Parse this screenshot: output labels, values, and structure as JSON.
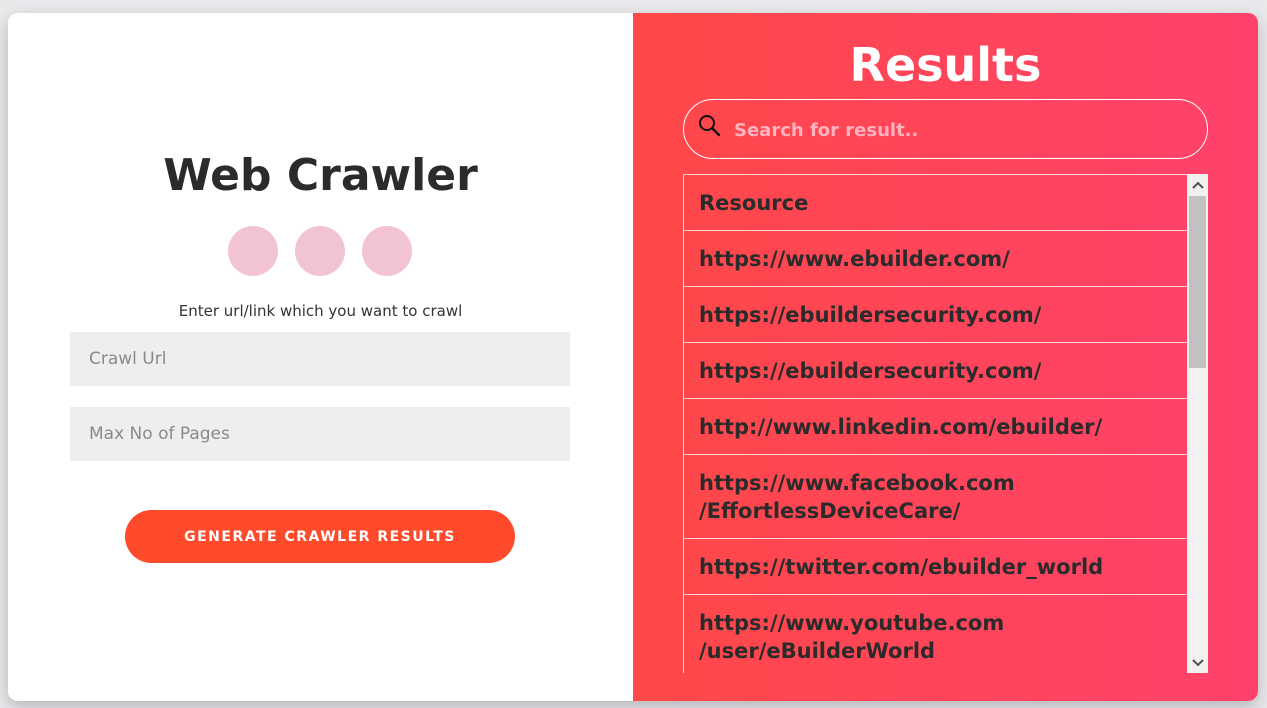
{
  "left": {
    "title": "Web Crawler",
    "hint": "Enter url/link which you want to crawl",
    "crawl_placeholder": "Crawl Url",
    "maxpages_placeholder": "Max No of Pages",
    "generate_label": "GENERATE CRAWLER RESULTS"
  },
  "right": {
    "title": "Results",
    "search_placeholder": "Search for result..",
    "header": "Resource",
    "rows": [
      "https://www.ebuilder.com/",
      "https://ebuildersecurity.com/",
      "https://ebuildersecurity.com/",
      "http://www.linkedin.com/ebuilder/",
      "https://www.facebook.com /EffortlessDeviceCare/",
      "https://twitter.com/ebuilder_world",
      "https://www.youtube.com /user/eBuilderWorld"
    ]
  },
  "icons": [
    "search-icon",
    "scroll-up-icon",
    "scroll-down-icon"
  ],
  "colors": {
    "accent_button": "#ff4b2b",
    "gradient_start": "#ff4848",
    "gradient_end": "#ff416c",
    "dot": "#f2c4d3"
  }
}
